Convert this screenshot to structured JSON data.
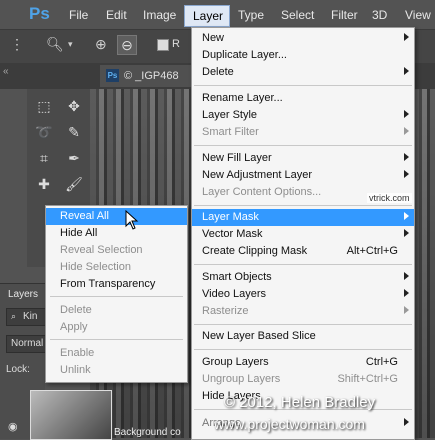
{
  "app": {
    "logo": "Ps"
  },
  "menubar": {
    "items": [
      "File",
      "Edit",
      "Image",
      "Layer",
      "Type",
      "Select",
      "Filter",
      "3D",
      "View"
    ]
  },
  "document_tab": {
    "title": "© _IGP468"
  },
  "watermarks": {
    "vtrick": "vtrick.com",
    "copyright": "© 2012, Helen Bradley",
    "site": "www.projectwoman.com"
  },
  "layers_panel": {
    "title": "Layers",
    "kind": "Kin",
    "blend": "Normal",
    "lock": "Lock:",
    "background_label": "Background co"
  },
  "layer_menu": {
    "items": [
      {
        "label": "New",
        "submenu": true
      },
      {
        "label": "Duplicate Layer..."
      },
      {
        "label": "Delete",
        "submenu": true
      },
      {
        "label": "Rename Layer..."
      },
      {
        "label": "Layer Style",
        "submenu": true
      },
      {
        "label": "Smart Filter",
        "disabled": true,
        "submenu": true
      },
      {
        "label": "New Fill Layer",
        "submenu": true
      },
      {
        "label": "New Adjustment Layer",
        "submenu": true
      },
      {
        "label": "Layer Content Options...",
        "disabled": true
      },
      {
        "label": "Layer Mask",
        "submenu": true,
        "highlighted": true
      },
      {
        "label": "Vector Mask",
        "submenu": true
      },
      {
        "label": "Create Clipping Mask",
        "shortcut": "Alt+Ctrl+G"
      },
      {
        "label": "Smart Objects",
        "submenu": true
      },
      {
        "label": "Video Layers",
        "submenu": true
      },
      {
        "label": "Rasterize",
        "disabled": true,
        "submenu": true
      },
      {
        "label": "New Layer Based Slice"
      },
      {
        "label": "Group Layers",
        "shortcut": "Ctrl+G"
      },
      {
        "label": "Ungroup Layers",
        "shortcut": "Shift+Ctrl+G",
        "disabled": true
      },
      {
        "label": "Hide Layers"
      },
      {
        "label": "Arrange",
        "submenu": true
      }
    ]
  },
  "layer_mask_submenu": {
    "items": [
      {
        "label": "Reveal All",
        "highlighted": true
      },
      {
        "label": "Hide All"
      },
      {
        "label": "Reveal Selection",
        "disabled": true
      },
      {
        "label": "Hide Selection",
        "disabled": true
      },
      {
        "label": "From Transparency"
      },
      {
        "label": "Delete",
        "disabled": true
      },
      {
        "label": "Apply",
        "disabled": true
      },
      {
        "label": "Enable",
        "disabled": true
      },
      {
        "label": "Unlink",
        "disabled": true
      }
    ]
  },
  "colors": {
    "highlight": "#3399ff",
    "menu_bg": "#f5f5f5",
    "app_bg": "#535353"
  }
}
